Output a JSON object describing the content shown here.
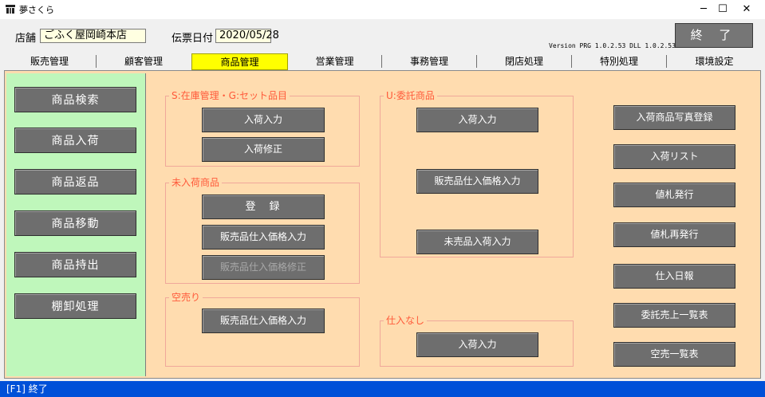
{
  "window": {
    "title": "夢さくら",
    "minimize": "─",
    "maximize": "☐",
    "close": "✕"
  },
  "header": {
    "store_label": "店舗",
    "store_value": "ごふく屋岡崎本店",
    "date_label": "伝票日付",
    "date_value": "2020/05/28",
    "version": "Version PRG 1.0.2.53 DLL 1.0.2.53",
    "exit_label": "終 了"
  },
  "tabs": [
    {
      "label": "販売管理"
    },
    {
      "label": "顧客管理"
    },
    {
      "label": "商品管理"
    },
    {
      "label": "営業管理"
    },
    {
      "label": "事務管理"
    },
    {
      "label": "閉店処理"
    },
    {
      "label": "特別処理"
    },
    {
      "label": "環境設定"
    }
  ],
  "left_menu": [
    {
      "label": "商品検索"
    },
    {
      "label": "商品入荷"
    },
    {
      "label": "商品返品"
    },
    {
      "label": "商品移動"
    },
    {
      "label": "商品持出"
    },
    {
      "label": "棚卸処理"
    }
  ],
  "groups": {
    "stock": {
      "title": "S:在庫管理・G:セット品目",
      "buttons": [
        {
          "label": "入荷入力"
        },
        {
          "label": "入荷修正"
        }
      ]
    },
    "not_arrived": {
      "title": "未入荷商品",
      "buttons": [
        {
          "label": "登　録"
        },
        {
          "label": "販売品仕入価格入力"
        },
        {
          "label": "販売品仕入価格修正"
        }
      ]
    },
    "empty_sale": {
      "title": "空売り",
      "buttons": [
        {
          "label": "販売品仕入価格入力"
        }
      ]
    },
    "consignment": {
      "title": "U:委託商品",
      "buttons": [
        {
          "label": "入荷入力"
        },
        {
          "label": "販売品仕入価格入力"
        },
        {
          "label": "未売品入荷入力"
        }
      ]
    },
    "no_purchase": {
      "title": "仕入なし",
      "buttons": [
        {
          "label": "入荷入力"
        }
      ]
    }
  },
  "right_buttons": [
    {
      "label": "入荷商品写真登録"
    },
    {
      "label": "入荷リスト"
    },
    {
      "label": "値札発行"
    },
    {
      "label": "値札再発行"
    },
    {
      "label": "仕入日報"
    },
    {
      "label": "委託売上一覧表"
    },
    {
      "label": "空売一覧表"
    }
  ],
  "status": {
    "text": "[F1] 終了"
  }
}
